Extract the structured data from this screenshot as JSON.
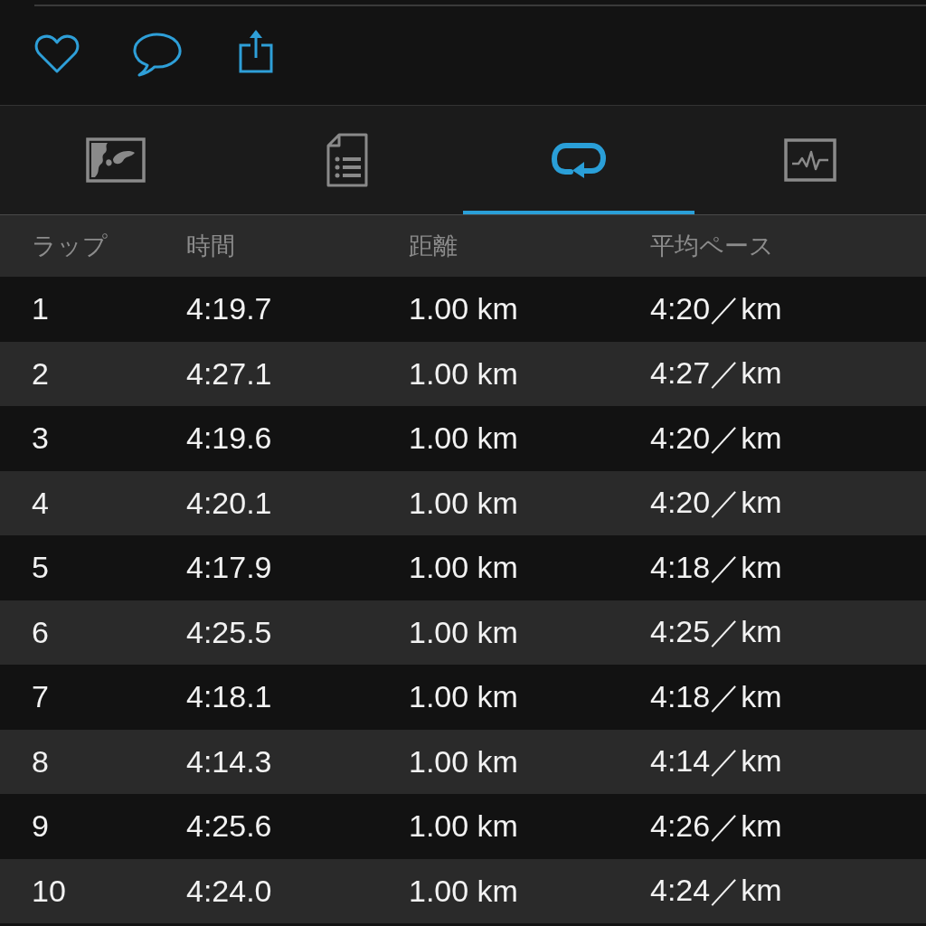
{
  "tabs": [
    {
      "kind": "map",
      "selected": false
    },
    {
      "kind": "details",
      "selected": false
    },
    {
      "kind": "laps",
      "selected": true
    },
    {
      "kind": "chart",
      "selected": false
    }
  ],
  "table": {
    "columns": [
      "ラップ",
      "時間",
      "距離",
      "平均ペース"
    ],
    "rows": [
      [
        "1",
        "4:19.7",
        "1.00 km",
        "4:20／km"
      ],
      [
        "2",
        "4:27.1",
        "1.00 km",
        "4:27／km"
      ],
      [
        "3",
        "4:19.6",
        "1.00 km",
        "4:20／km"
      ],
      [
        "4",
        "4:20.1",
        "1.00 km",
        "4:20／km"
      ],
      [
        "5",
        "4:17.9",
        "1.00 km",
        "4:18／km"
      ],
      [
        "6",
        "4:25.5",
        "1.00 km",
        "4:25／km"
      ],
      [
        "7",
        "4:18.1",
        "1.00 km",
        "4:18／km"
      ],
      [
        "8",
        "4:14.3",
        "1.00 km",
        "4:14／km"
      ],
      [
        "9",
        "4:25.6",
        "1.00 km",
        "4:26／km"
      ],
      [
        "10",
        "4:24.0",
        "1.00 km",
        "4:24／km"
      ]
    ]
  }
}
